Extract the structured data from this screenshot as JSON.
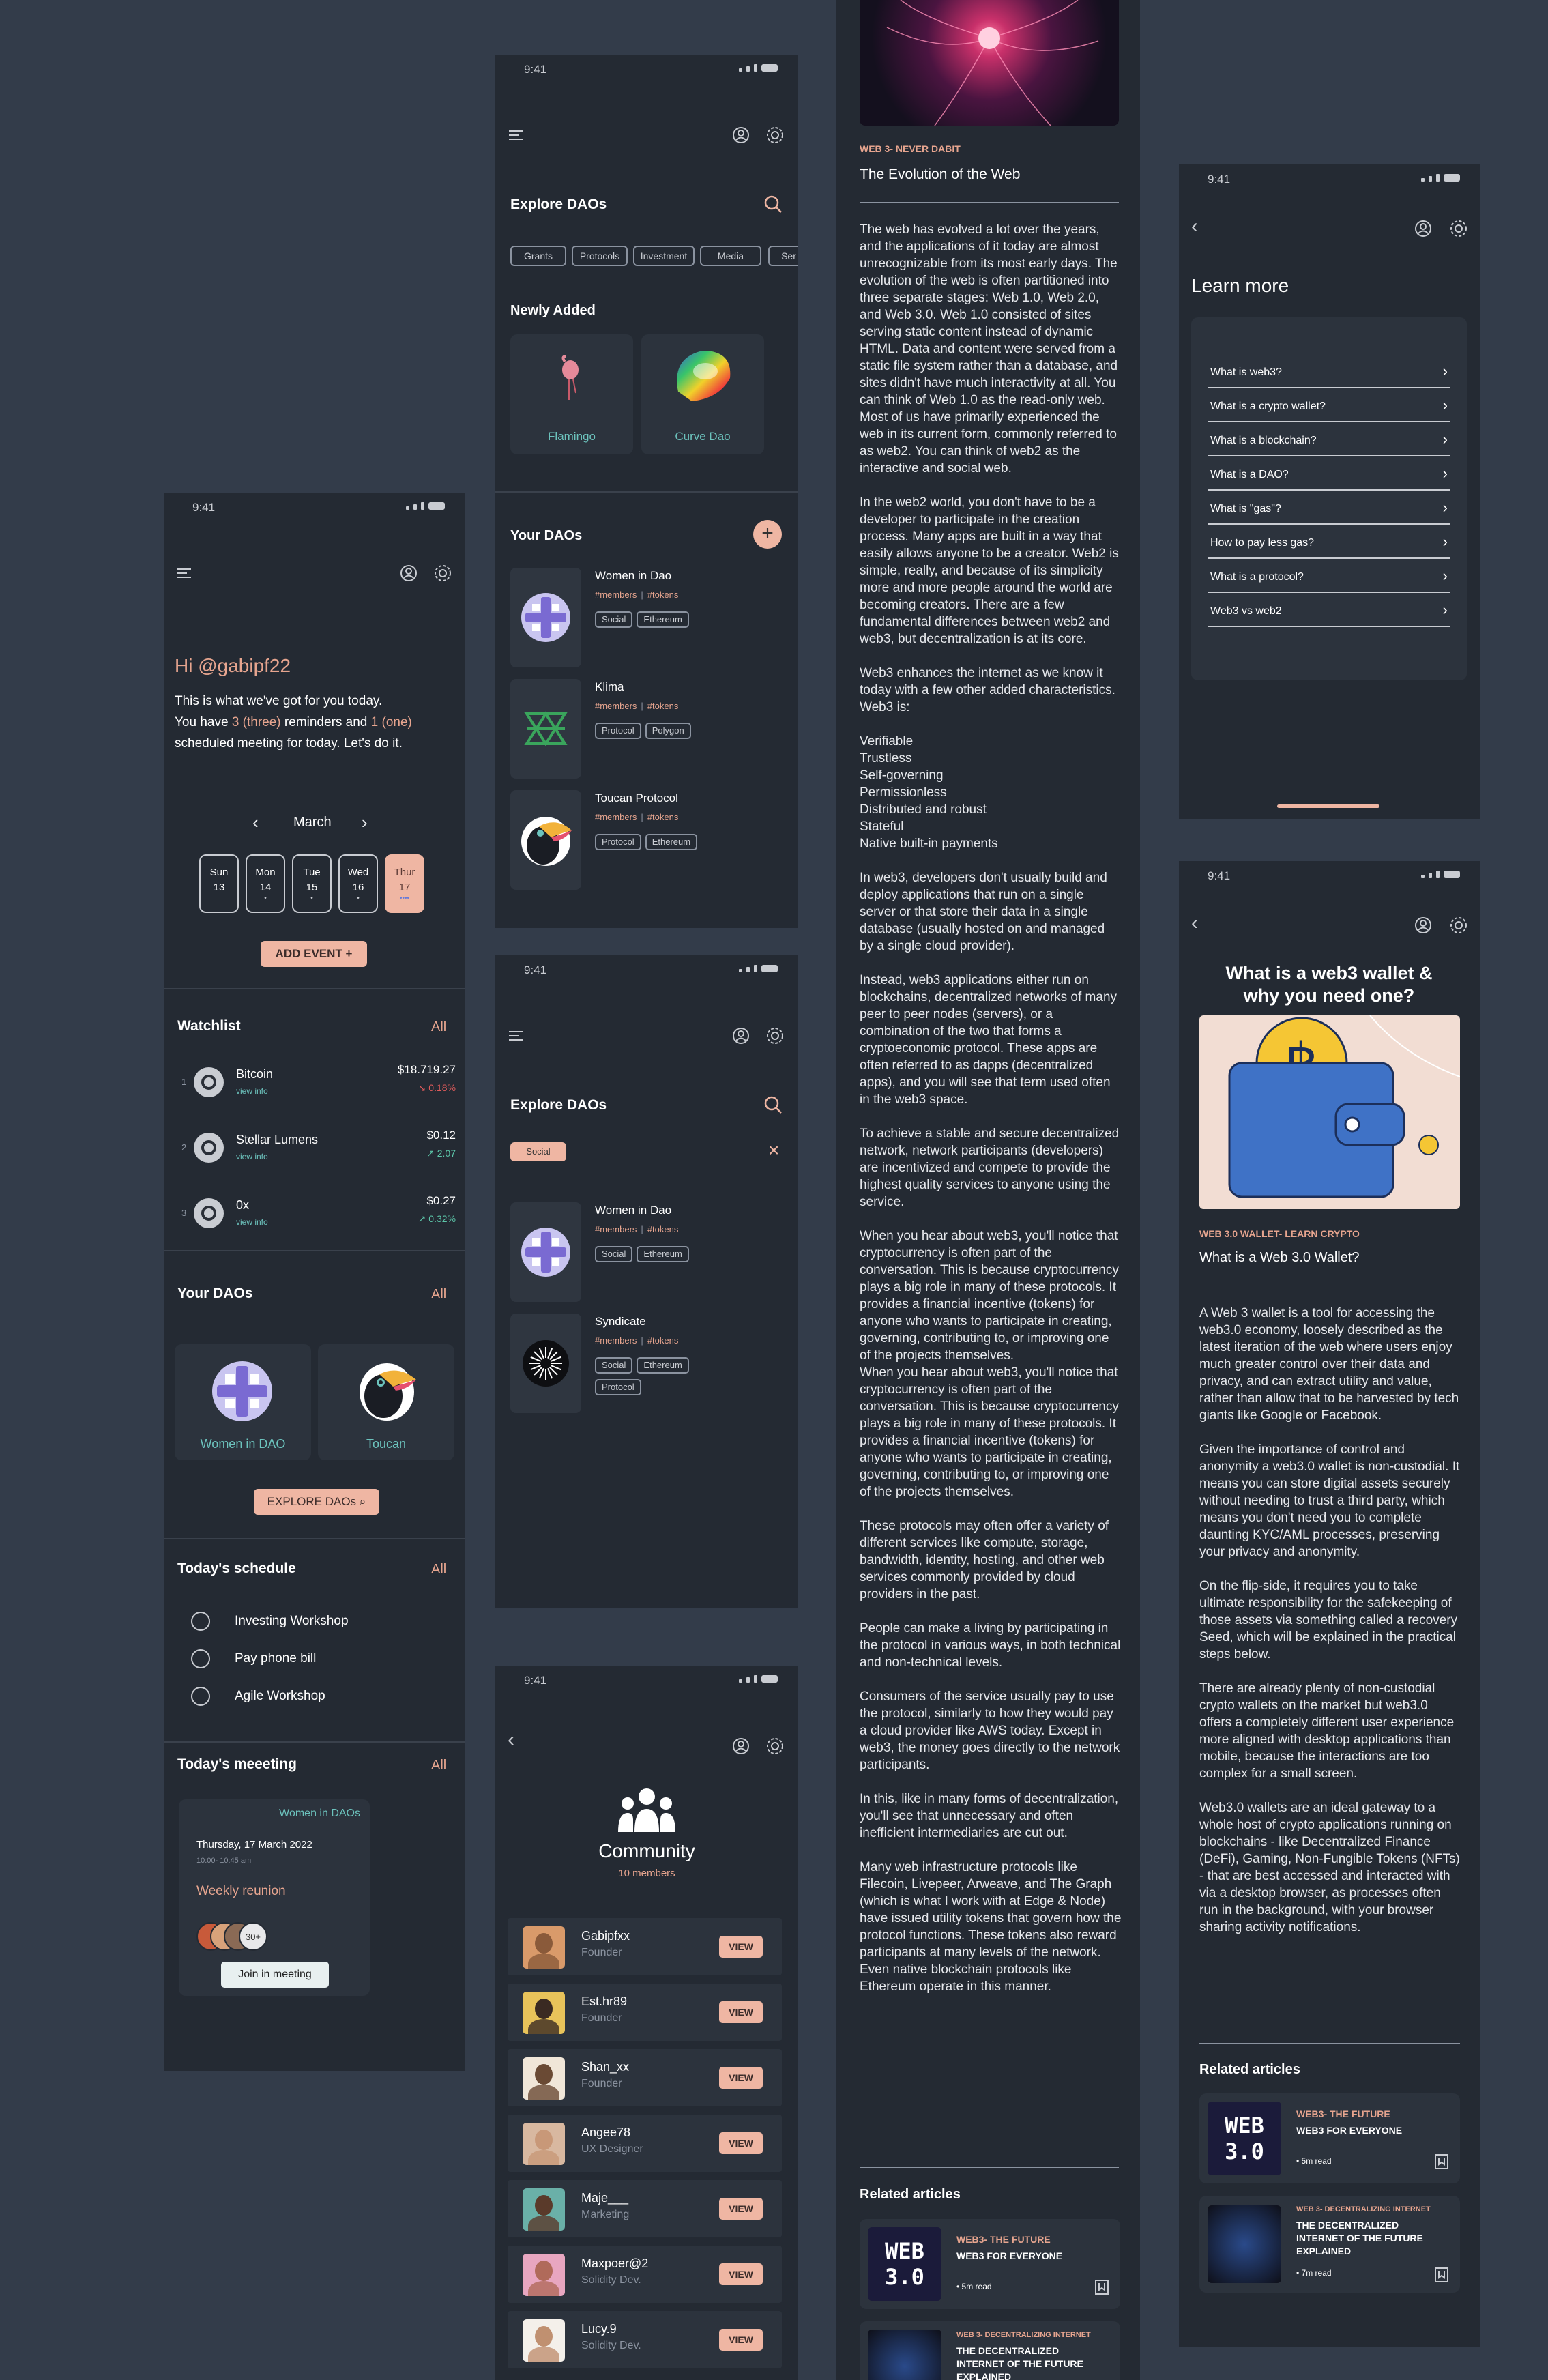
{
  "status_time": "9:41",
  "home": {
    "greeting": "Hi @gabipf22",
    "intro_1": "This is what we've got for you today.",
    "intro_2a": "You have ",
    "intro_2b": "3 (three)",
    "intro_2c": " reminders and ",
    "intro_2d": "1 (one)",
    "intro_3": "scheduled meeting for today. Let's do it.",
    "month": "March",
    "days": [
      {
        "d": "Sun",
        "n": "13"
      },
      {
        "d": "Mon",
        "n": "14"
      },
      {
        "d": "Tue",
        "n": "15"
      },
      {
        "d": "Wed",
        "n": "16"
      },
      {
        "d": "Thur",
        "n": "17"
      }
    ],
    "add_event": "ADD EVENT +",
    "watchlist_title": "Watchlist",
    "all": "All",
    "coins": [
      {
        "rank": "1",
        "name": "Bitcoin",
        "sub": "view info",
        "price": "$18.719.27",
        "change": "↘ 0.18%"
      },
      {
        "rank": "2",
        "name": "Stellar Lumens",
        "sub": "view info",
        "price": "$0.12",
        "change": "↗ 2.07"
      },
      {
        "rank": "3",
        "name": "0x",
        "sub": "view info",
        "price": "$0.27",
        "change": "↗ 0.32%"
      }
    ],
    "your_daos": "Your DAOs",
    "dao_cards": [
      "Women in DAO",
      "Toucan"
    ],
    "explore": "EXPLORE DAOs",
    "schedule_title": "Today's schedule",
    "schedule": [
      "Investing Workshop",
      "Pay phone bill",
      "Agile Workshop"
    ],
    "meeting_title": "Today's meeeting",
    "meeting_org": "Women in DAOs",
    "meeting_date": "Thursday, 17 March 2022",
    "meeting_time": "10:00- 10:45 am",
    "meeting_name": "Weekly reunion",
    "meeting_more": "30+",
    "join": "Join in meeting"
  },
  "explore1": {
    "title": "Explore DAOs",
    "chips": [
      "Grants",
      "Protocols",
      "Investment",
      "Media",
      "Ser"
    ],
    "newly": "Newly Added",
    "new_items": [
      "Flamingo",
      "Curve Dao"
    ],
    "your": "Your DAOs",
    "daos": [
      {
        "name": "Women in Dao",
        "m": "#members",
        "t": "#tokens",
        "tags": [
          "Social",
          "Ethereum"
        ]
      },
      {
        "name": "Klima",
        "m": "#members",
        "t": "#tokens",
        "tags": [
          "Protocol",
          "Polygon"
        ]
      },
      {
        "name": "Toucan Protocol",
        "m": "#members",
        "t": "#tokens",
        "tags": [
          "Protocol",
          "Ethereum"
        ]
      }
    ]
  },
  "explore2": {
    "title": "Explore DAOs",
    "filter": "Social",
    "daos": [
      {
        "name": "Women in Dao",
        "m": "#members",
        "t": "#tokens",
        "tags": [
          "Social",
          "Ethereum"
        ]
      },
      {
        "name": "Syndicate",
        "m": "#members",
        "t": "#tokens",
        "tags": [
          "Social",
          "Ethereum",
          "Protocol"
        ]
      }
    ]
  },
  "community": {
    "title": "Community",
    "count": "10 members",
    "view": "VIEW",
    "members": [
      {
        "name": "Gabipfxx",
        "role": "Founder"
      },
      {
        "name": "Est.hr89",
        "role": "Founder"
      },
      {
        "name": "Shan_xx",
        "role": "Founder"
      },
      {
        "name": "Angee78",
        "role": "UX Designer"
      },
      {
        "name": "Maje___",
        "role": "Marketing"
      },
      {
        "name": "Maxpoer@2",
        "role": "Solidity Dev."
      },
      {
        "name": "Lucy.9",
        "role": "Solidity Dev."
      }
    ]
  },
  "article": {
    "kicker": "WEB 3- NEVER DABIT",
    "title": "The Evolution of the Web",
    "p1": "The web has evolved a lot over the years, and the applications of it today are almost unrecognizable from its most early days. The evolution of the web is often partitioned into three separate stages: Web 1.0, Web 2.0, and Web 3.0. Web 1.0 consisted of sites serving static content instead of dynamic HTML. Data and content were served from a static file system rather than a database, and sites didn't have much interactivity at all. You can think of Web 1.0 as the read-only web.",
    "p1b": "Most of us have primarily experienced the web in its current form, commonly referred to as web2. You can think of web2 as the interactive and social web.",
    "p2": "In the web2 world, you don't have to be a developer to participate in the creation process. Many apps are built in a way that easily allows anyone to be a creator. Web2 is simple, really, and because of its simplicity more and more people around the world are becoming creators. There are a few fundamental differences between web2 and web3, but decentralization is at its core.",
    "p3": "Web3 enhances the internet as we know it today with a few other added characteristics. Web3 is:",
    "list": [
      "Verifiable",
      "Trustless",
      "Self-governing",
      "Permissionless",
      "Distributed and robust",
      "Stateful",
      "Native built-in payments"
    ],
    "p4": "In web3, developers don't usually build and deploy applications that run on a single server or that store their data in a single database (usually hosted on and managed by a single cloud provider).",
    "p5": "Instead, web3 applications either run on blockchains, decentralized networks of many peer to peer nodes (servers), or a combination of the two that forms a cryptoeconomic protocol. These apps are often referred to as dapps (decentralized apps), and you will see that term used often in the web3 space.",
    "p6": "To achieve a stable and secure decentralized network, network participants (developers) are incentivized and compete to provide the highest quality services to anyone using the service.",
    "p7": "When you hear about web3, you'll notice that cryptocurrency is often part of the conversation. This is because cryptocurrency plays a big role in many of these protocols. It provides a financial incentive (tokens) for anyone who wants to participate in creating, governing, contributing to, or improving one of the projects themselves.",
    "p8": "These protocols may often offer a variety of different services like compute, storage, bandwidth, identity, hosting, and other web services commonly provided by cloud providers in the past.",
    "p9": "People can make a living by participating in the protocol in various ways, in both technical and non-technical levels.",
    "p10": "Consumers of the service usually pay to use the protocol, similarly to how they would pay a cloud provider like AWS today. Except in web3, the money goes directly to the network participants.",
    "p11": "In this, like in many forms of decentralization, you'll see that unnecessary and often inefficient intermediaries are cut out.",
    "p12": "Many web infrastructure protocols like Filecoin, Livepeer, Arweave, and The Graph (which is what I work with at Edge & Node) have issued utility tokens that govern how the protocol functions. These tokens also reward participants at many levels of the network. Even native blockchain protocols like Ethereum operate in this manner.",
    "related": "Related articles",
    "r1_kicker": "WEB3- THE FUTURE",
    "r1_title": "WEB3 FOR EVERYONE",
    "r1_read": "• 5m read",
    "r2_kicker": "WEB 3- DECENTRALIZING INTERNET",
    "r2_title": "THE DECENTRALIZED INTERNET OF THE FUTURE EXPLAINED",
    "r2_read": "• 7m read",
    "badge": "WEB 3.0"
  },
  "learn": {
    "title": "Learn more",
    "items": [
      "What is web3?",
      "What is a crypto wallet?",
      "What is a blockchain?",
      "What is a DAO?",
      "What is \"gas\"?",
      "How to pay less gas?",
      "What is a protocol?",
      "Web3 vs web2"
    ]
  },
  "wallet": {
    "title": "What is a web3 wallet & why you need one?",
    "kicker": "WEB 3.0 WALLET- LEARN CRYPTO",
    "subtitle": "What is a Web 3.0 Wallet?",
    "p1": "A Web 3 wallet is a tool for accessing the web3.0 economy, loosely described as the latest iteration of the web where users enjoy much greater control over their data and privacy, and can extract utility and value, rather than allow that to be harvested by tech giants like Google or Facebook.",
    "p2": "Given the importance of control and anonymity a web3.0 wallet is non-custodial. It means you can store digital assets securely without needing to trust a third party, which means you don't need you to complete daunting KYC/AML processes, preserving your privacy and anonymity.",
    "p3": "On the flip-side, it requires you to take ultimate responsibility for the safekeeping of those assets via something called a recovery Seed, which will be explained in the practical steps below.",
    "p4": "There are already plenty of non-custodial crypto wallets on the market but web3.0 offers a completely different user experience more aligned with desktop applications than mobile, because the interactions are too complex for a small screen.",
    "p5": "Web3.0 wallets are an ideal gateway to a whole host of crypto applications running on blockchains - like Decentralized Finance (DeFi), Gaming, Non-Fungible Tokens (NFTs) - that are best accessed and interacted with via a desktop browser, as processes often run in the background, with your browser sharing activity notifications.",
    "related": "Related articles"
  },
  "colors": {
    "bg": "#333c4a",
    "screen": "#242a33",
    "accent": "#efb6a3",
    "teal": "#6cc3bd"
  }
}
